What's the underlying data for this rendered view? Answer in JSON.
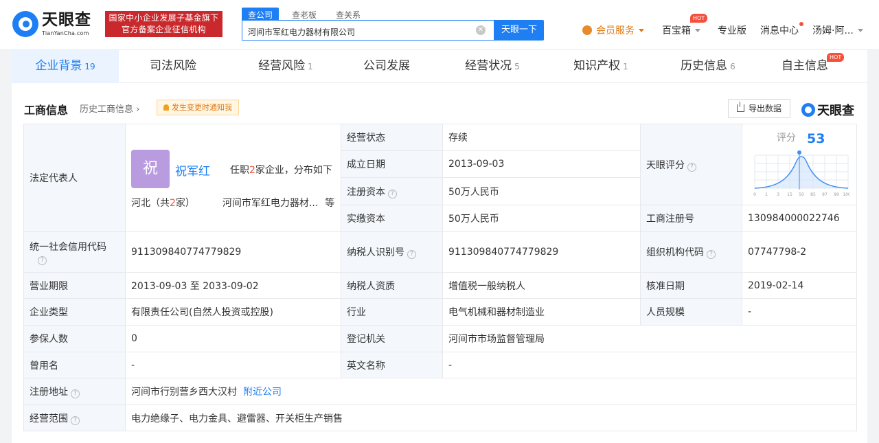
{
  "brand": {
    "name_cn": "天眼查",
    "name_en": "TianYanCha.com",
    "badge_line1": "国家中小企业发展子基金旗下",
    "badge_line2": "官方备案企业征信机构"
  },
  "search": {
    "tabs": [
      "查公司",
      "查老板",
      "查关系"
    ],
    "value": "河间市军红电力器材有限公司",
    "button": "天眼一下"
  },
  "nav": {
    "vip": "会员服务",
    "box": "百宝箱",
    "box_badge": "HOT",
    "pro": "专业版",
    "messages": "消息中心",
    "user": "汤姆·阿..."
  },
  "tabs": [
    {
      "label": "企业背景",
      "count": "19"
    },
    {
      "label": "司法风险",
      "count": ""
    },
    {
      "label": "经营风险",
      "count": "1"
    },
    {
      "label": "公司发展",
      "count": ""
    },
    {
      "label": "经营状况",
      "count": "5"
    },
    {
      "label": "知识产权",
      "count": "1"
    },
    {
      "label": "历史信息",
      "count": "6"
    },
    {
      "label": "自主信息",
      "count": "",
      "badge": "HOT"
    }
  ],
  "section": {
    "title": "工商信息",
    "history_link": "历史工商信息",
    "notify": "发生变更时通知我",
    "export": "导出数据",
    "brand_small": "天眼查"
  },
  "legal_rep": {
    "label": "法定代表人",
    "avatar_char": "祝",
    "name": "祝军红",
    "info_pre": "任职",
    "info_count": "2",
    "info_post": "家企业，分布如下",
    "region_pre": "河北（共",
    "region_count": "2",
    "region_post": "家）",
    "company": "河间市军红电力器材...",
    "etc": "等"
  },
  "score": {
    "label": "天眼评分",
    "title": "评分",
    "value": "53",
    "axis": [
      "0",
      "1",
      "3",
      "15",
      "50",
      "85",
      "97",
      "99",
      "100"
    ]
  },
  "fields": {
    "status_label": "经营状态",
    "status": "存续",
    "est_label": "成立日期",
    "est": "2013-09-03",
    "reg_cap_label": "注册资本",
    "reg_cap": "50万人民币",
    "paid_cap_label": "实缴资本",
    "paid_cap": "50万人民币",
    "reg_no_label": "工商注册号",
    "reg_no": "130984000022746",
    "credit_label": "统一社会信用代码",
    "credit": "911309840774779829",
    "taxid_label": "纳税人识别号",
    "taxid": "911309840774779829",
    "org_label": "组织机构代码",
    "org": "07747798-2",
    "term_label": "营业期限",
    "term": "2013-09-03 至 2033-09-02",
    "tax_qual_label": "纳税人资质",
    "tax_qual": "增值税一般纳税人",
    "approve_label": "核准日期",
    "approve": "2019-02-14",
    "type_label": "企业类型",
    "type": "有限责任公司(自然人投资或控股)",
    "industry_label": "行业",
    "industry": "电气机械和器材制造业",
    "staff_label": "人员规模",
    "staff": "-",
    "insured_label": "参保人数",
    "insured": "0",
    "authority_label": "登记机关",
    "authority": "河间市市场监督管理局",
    "former_label": "曾用名",
    "former": "-",
    "en_label": "英文名称",
    "en": "-",
    "address_label": "注册地址",
    "address": "河间市行别营乡西大汉村",
    "nearby": "附近公司",
    "scope_label": "经营范围",
    "scope": "电力绝缘子、电力金具、避雷器、开关柜生产销售"
  }
}
